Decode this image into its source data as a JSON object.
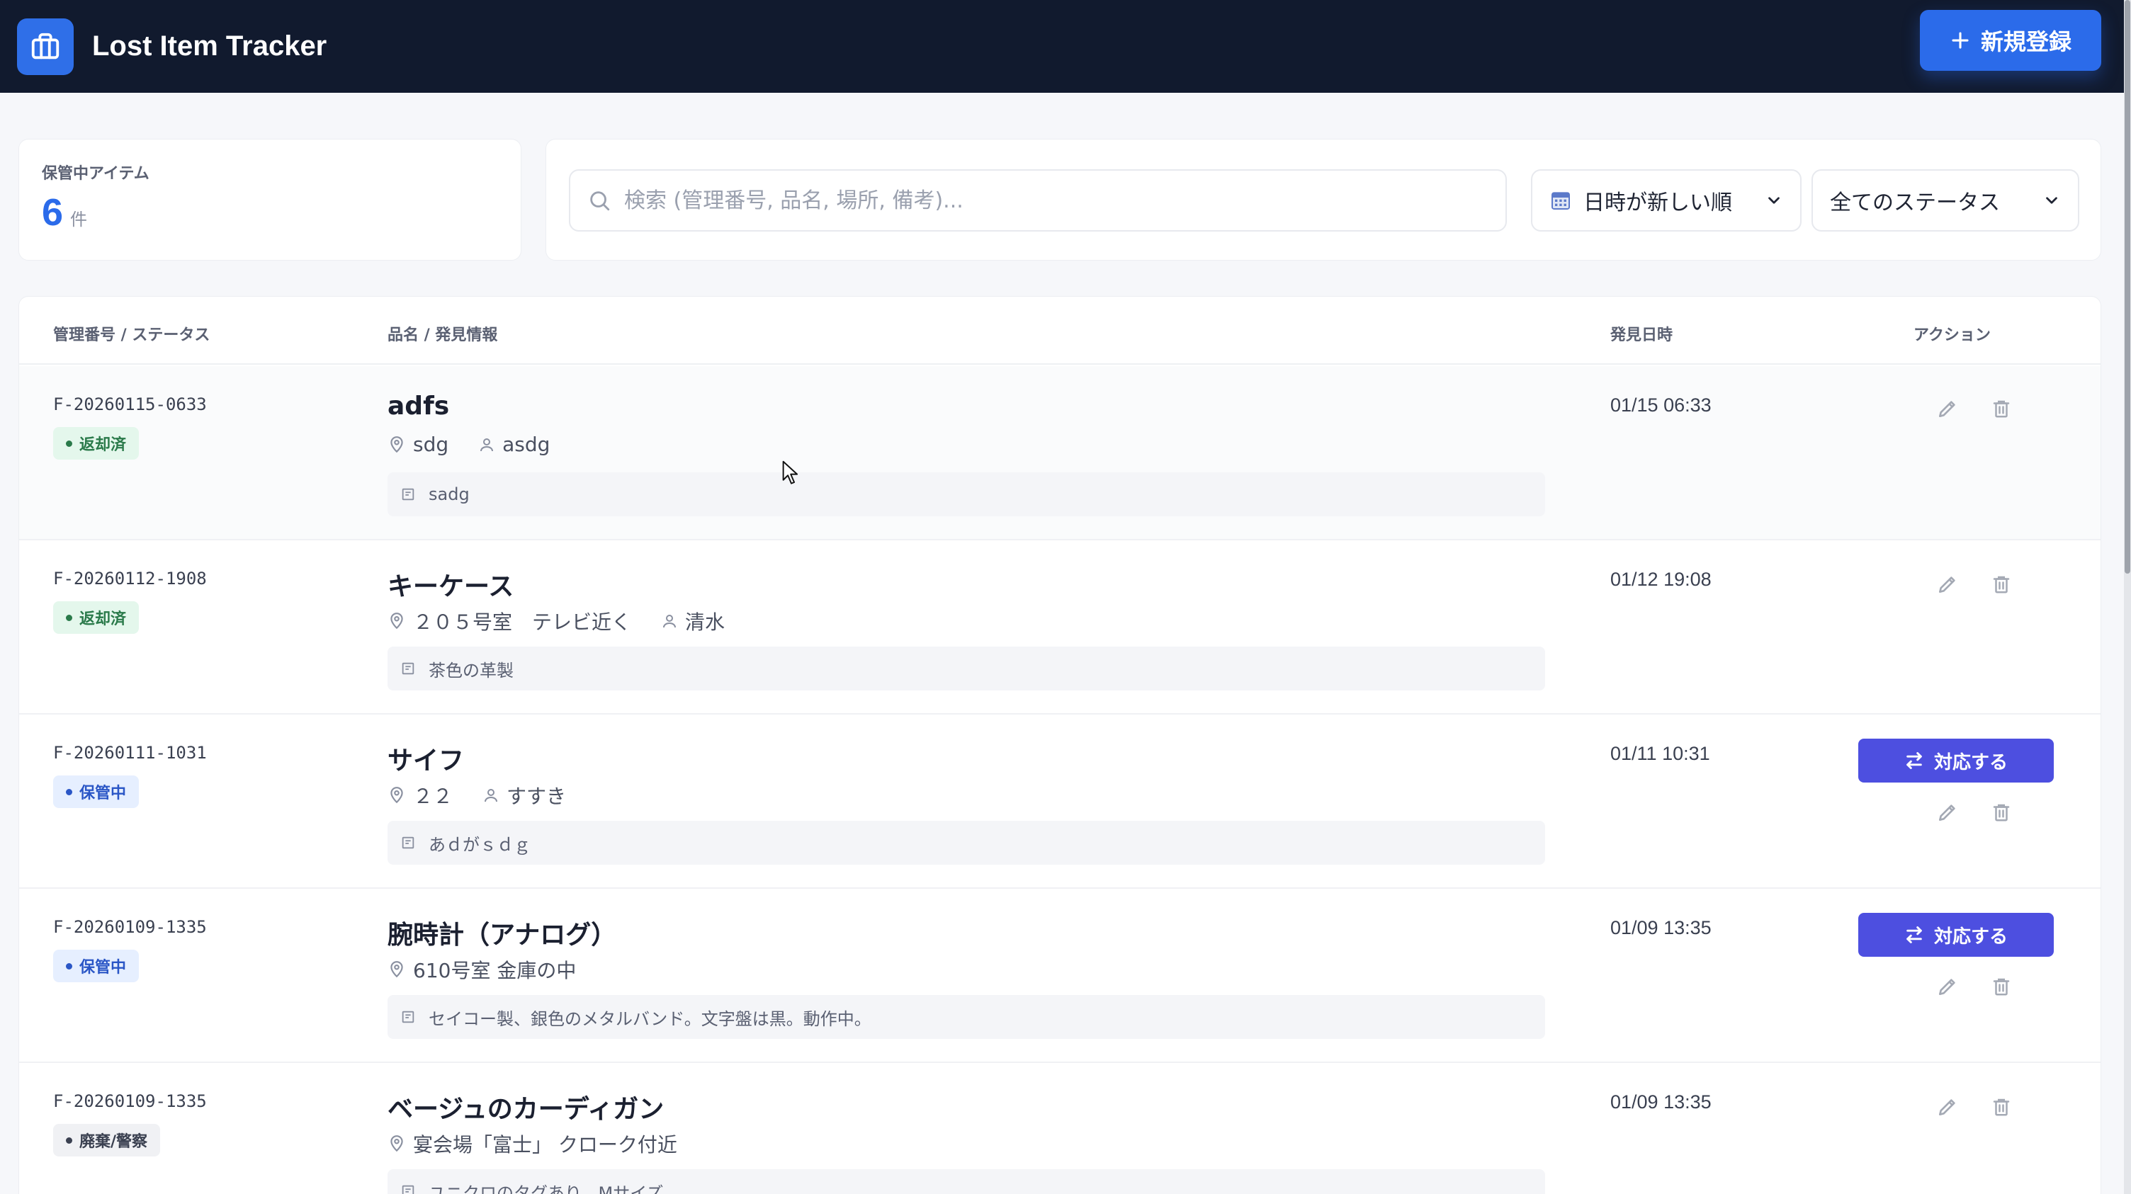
{
  "app": {
    "title": "Lost Item Tracker",
    "new_button_label": "新規登録"
  },
  "summary": {
    "label": "保管中アイテム",
    "count": "6",
    "unit": "件"
  },
  "filters": {
    "search_placeholder": "検索 (管理番号, 品名, 場所, 備考)...",
    "sort_selected": "日時が新しい順",
    "status_selected": "全てのステータス"
  },
  "table": {
    "headers": {
      "mgmt": "管理番号 / ステータス",
      "item": "品名 / 発見情報",
      "date": "発見日時",
      "action": "アクション"
    },
    "action_label": "対応する",
    "rows": [
      {
        "id": "F-20260115-0633",
        "status": "返却済",
        "name": "adfs",
        "place": "sdg",
        "finder": "asdg",
        "note": "sadg",
        "date": "01/15 06:33"
      },
      {
        "id": "F-20260112-1908",
        "status": "返却済",
        "name": "キーケース",
        "place": "２０５号室　テレビ近く",
        "finder": "清水",
        "note": "茶色の革製",
        "date": "01/12 19:08"
      },
      {
        "id": "F-20260111-1031",
        "status": "保管中",
        "name": "サイフ",
        "place": "２２",
        "finder": "すすき",
        "note": "あｄがｓｄｇ",
        "date": "01/11 10:31"
      },
      {
        "id": "F-20260109-1335",
        "status": "保管中",
        "name": "腕時計（アナログ）",
        "place": "610号室 金庫の中",
        "finder": "",
        "note": "セイコー製、銀色のメタルバンド。文字盤は黒。動作中。",
        "date": "01/09 13:35"
      },
      {
        "id": "F-20260109-1335",
        "status": "廃棄/警察",
        "name": "ベージュのカーディガン",
        "place": "宴会場「富士」 クローク付近",
        "finder": "",
        "note": "ユニクロのタグあり。Mサイズ。",
        "date": "01/09 13:35"
      }
    ]
  },
  "colors": {
    "header_bg": "#111a2e",
    "primary": "#2b6bea",
    "action": "#4d4fe0",
    "returned_badge": "#e4f7ec",
    "stored_badge": "#e6efff",
    "disposed_badge": "#f0f1f4"
  },
  "icons": {
    "logo": "briefcase-icon",
    "new": "plus-icon",
    "search": "search-icon",
    "sort": "calendar-icon",
    "place": "map-pin-icon",
    "finder": "user-icon",
    "note": "note-icon",
    "action": "swap-icon",
    "edit": "pencil-icon",
    "delete": "trash-icon"
  }
}
